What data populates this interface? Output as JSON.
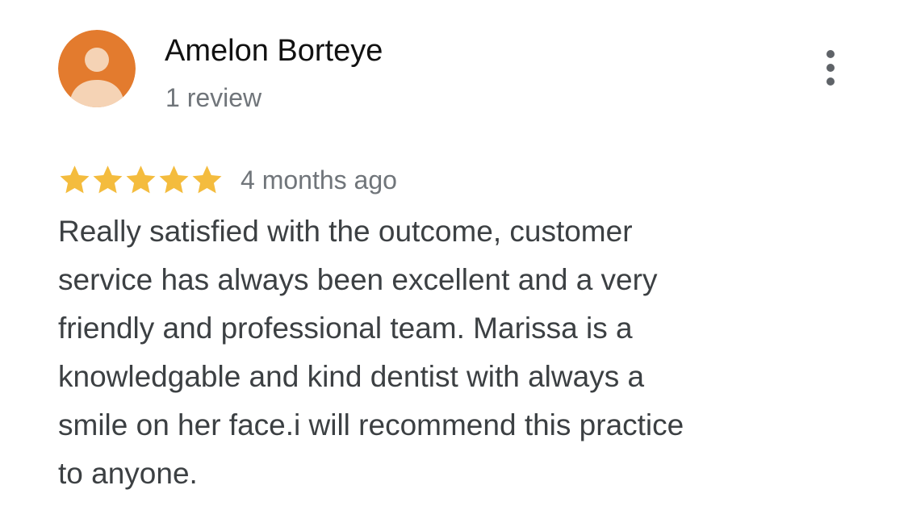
{
  "reviewer": {
    "name": "Amelon Borteye",
    "review_count": "1 review",
    "avatar_icon": "person-avatar-icon",
    "avatar_color": "#E37B2E"
  },
  "menu": {
    "icon": "more-vert-icon"
  },
  "review": {
    "rating": 5,
    "rating_max": 5,
    "star_color": "#F4BC3E",
    "date": "4 months ago",
    "text_lines": [
      "Really satisfied with the outcome, customer",
      "service has always been excellent and a very",
      "friendly and professional team. Marissa is a",
      "knowledgable and kind dentist with always a",
      "smile on her face.i will recommend this practice",
      "to anyone."
    ]
  }
}
